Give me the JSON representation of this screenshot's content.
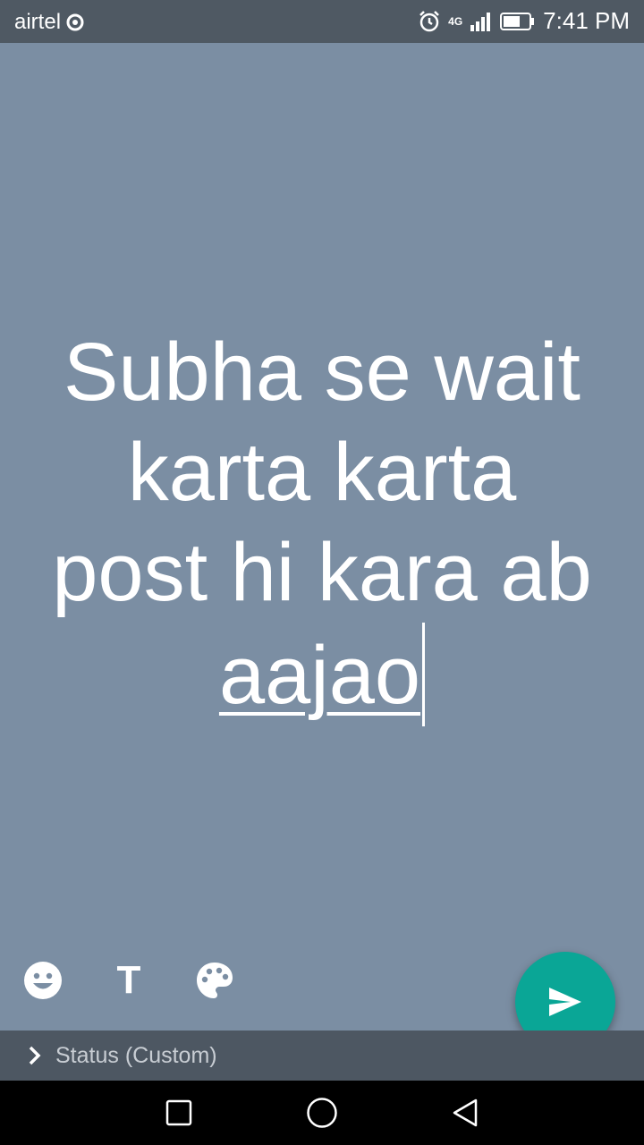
{
  "status_bar": {
    "carrier": "airtel",
    "network": "4G",
    "time": "7:41 PM"
  },
  "composer": {
    "line1": "Subha se wait",
    "line2": "karta karta",
    "line3": "post hi kara ab",
    "line4": "aajao",
    "background_color": "#7b8ea3"
  },
  "toolbar": {
    "emoji_icon": "emoji-icon",
    "text_icon": "T",
    "palette_icon": "palette-icon"
  },
  "send_button": {
    "icon": "send-icon",
    "color": "#0aa696"
  },
  "caption_bar": {
    "label": "Status (Custom)"
  },
  "nav_bar": {
    "buttons": [
      "recents-icon",
      "home-icon",
      "back-icon"
    ]
  }
}
